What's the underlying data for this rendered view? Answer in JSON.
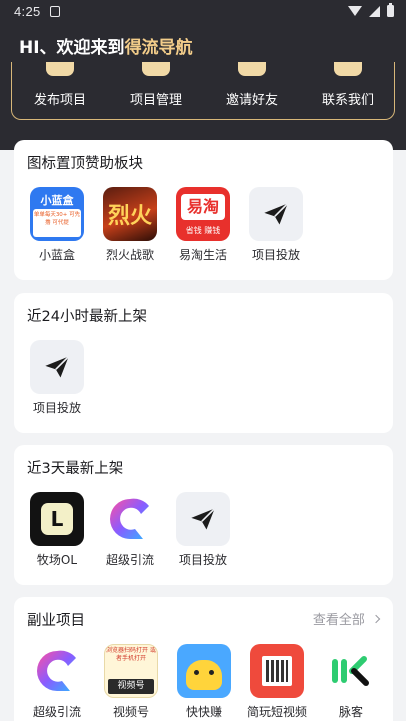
{
  "status_bar": {
    "time": "4:25"
  },
  "header": {
    "greeting_prefix": "HI、欢迎来到",
    "greeting_brand": "得流导航",
    "actions": [
      {
        "label": "发布项目",
        "icon": "publish-icon"
      },
      {
        "label": "项目管理",
        "icon": "manage-icon"
      },
      {
        "label": "邀请好友",
        "icon": "invite-icon"
      },
      {
        "label": "联系我们",
        "icon": "contact-icon"
      }
    ]
  },
  "sections": {
    "sponsored": {
      "title": "图标置顶赞助板块",
      "apps": [
        {
          "name": "小蓝盒",
          "icon_text": "小蓝盒",
          "icon_sub": "单单每天30+ 可先撸 可代提"
        },
        {
          "name": "烈火战歌",
          "icon_text": "烈火"
        },
        {
          "name": "易淘生活",
          "icon_text": "易淘",
          "icon_sub": "省钱 赚钱"
        },
        {
          "name": "项目投放"
        }
      ]
    },
    "last_24h": {
      "title": "近24小时最新上架",
      "apps": [
        {
          "name": "项目投放"
        }
      ]
    },
    "last_3d": {
      "title": "近3天最新上架",
      "apps": [
        {
          "name": "牧场OL",
          "icon_text": "L"
        },
        {
          "name": "超级引流"
        },
        {
          "name": "项目投放"
        }
      ]
    },
    "side_projects": {
      "title": "副业项目",
      "more": "查看全部",
      "apps": [
        {
          "name": "超级引流"
        },
        {
          "name": "视频号",
          "icon_text": "视频号",
          "icon_sub": "浏览器扫码打开 或者手机打开"
        },
        {
          "name": "快快赚"
        },
        {
          "name": "简玩短视频"
        },
        {
          "name": "脉客"
        }
      ]
    }
  },
  "colors": {
    "header_bg": "#2b2b31",
    "gold": "#f3cd8a",
    "page_bg": "#f2f3f5"
  }
}
